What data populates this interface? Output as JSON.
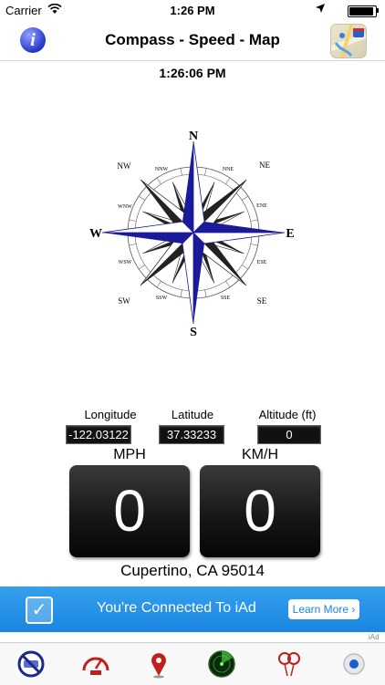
{
  "status_bar": {
    "carrier": "Carrier",
    "time": "1:26 PM"
  },
  "nav": {
    "title": "Compass - Speed - Map",
    "info_icon": "i"
  },
  "clock": "1:26:06 PM",
  "compass": {
    "labels": {
      "N": "N",
      "NNE": "NNE",
      "NE": "NE",
      "ENE": "ENE",
      "E": "E",
      "ESE": "ESE",
      "SE": "SE",
      "SSE": "SSE",
      "S": "S",
      "SSW": "SSW",
      "SW": "SW",
      "WSW": "WSW",
      "W": "W",
      "WNW": "WNW",
      "NW": "NW",
      "NNW": "NNW"
    }
  },
  "location": {
    "longitude_label": "Longitude",
    "latitude_label": "Latitude",
    "altitude_label": "Altitude (ft)",
    "longitude": "-122.03122",
    "latitude": "37.33233",
    "altitude": "0"
  },
  "speed": {
    "mph_label": "MPH",
    "kmh_label": "KM/H",
    "mph": "0",
    "kmh": "0"
  },
  "address": "Cupertino, CA 95014",
  "ad": {
    "text": "You're Connected To iAd",
    "button": "Learn More ›",
    "tag": "iAd"
  },
  "tabs": [
    "no-ad-icon",
    "speedometer-icon",
    "map-pin-icon",
    "radar-icon",
    "balloons-icon",
    "record-icon"
  ],
  "colors": {
    "accent_blue": "#1a1a9a",
    "ad_blue": "#1a86e0"
  }
}
